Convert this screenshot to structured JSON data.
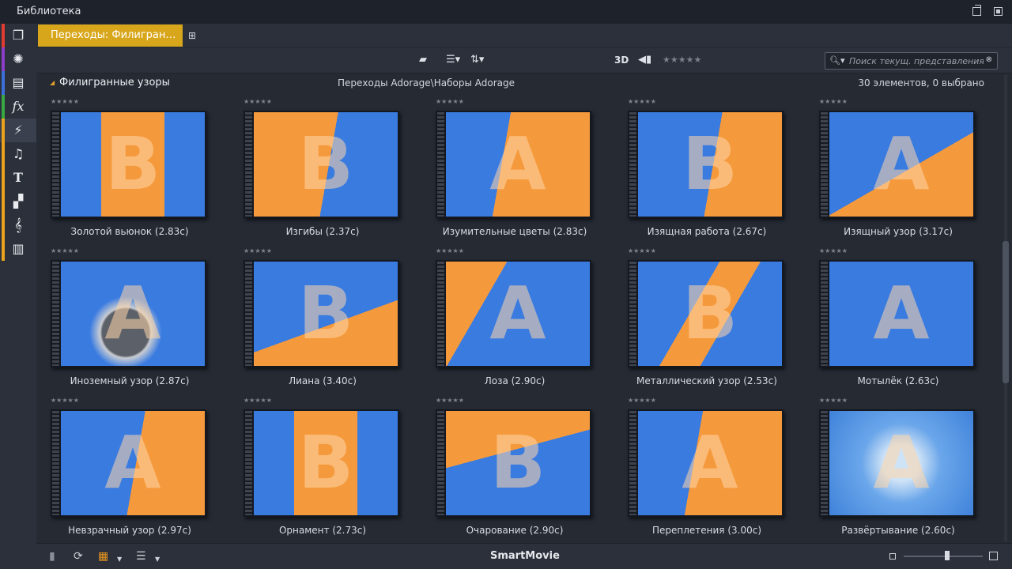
{
  "window": {
    "title": "Библиотека"
  },
  "sidebar": {
    "items": [
      {
        "name": "library-box-icon",
        "glyph": "❒",
        "color": "#e03c31"
      },
      {
        "name": "film-reel-icon",
        "glyph": "✺",
        "color": "#8a3ec9"
      },
      {
        "name": "photos-icon",
        "glyph": "▤",
        "color": "#3d6fd9"
      },
      {
        "name": "fx-icon",
        "glyph": "fx",
        "color": "#38a843"
      },
      {
        "name": "transition-bolt-icon",
        "glyph": "⚡",
        "color": "#e8a21c"
      },
      {
        "name": "music-note-icon",
        "glyph": "♫",
        "color": "#e8a21c"
      },
      {
        "name": "title-text-icon",
        "glyph": "T",
        "color": "#e8a21c"
      },
      {
        "name": "montage-icon",
        "glyph": "▞",
        "color": "#e8a21c"
      },
      {
        "name": "sound-effect-icon",
        "glyph": "𝄞",
        "color": "#e8a21c"
      },
      {
        "name": "disc-menu-icon",
        "glyph": "▥",
        "color": "#e8a21c"
      }
    ]
  },
  "tabs": {
    "active_label": "Переходы: Филигран…"
  },
  "toolbar": {
    "three_d": "3D",
    "stars": "★★★★★",
    "search_placeholder": "Поиск текущ. представления"
  },
  "content": {
    "folder_name": "Филигранные узоры",
    "path": "Переходы Adorage\\Наборы Adorage",
    "count": "30 элементов, 0 выбрано",
    "rating_stars": "★★★★★",
    "items": [
      {
        "label": "Золотой вьюнок (2.83с)",
        "letter": "B",
        "bg": "#3a7be0",
        "accent": "#f59a3c",
        "style": "stripe-v"
      },
      {
        "label": "Изгибы (2.37с)",
        "letter": "B",
        "bg": "#f59a3c",
        "accent": "#3a7be0",
        "style": "right"
      },
      {
        "label": "Изумительные цветы (2.83с)",
        "letter": "A",
        "bg": "#f59a3c",
        "accent": "#3a7be0",
        "style": "left"
      },
      {
        "label": "Изящная работа (2.67с)",
        "letter": "B",
        "bg": "#3a7be0",
        "accent": "#f59a3c",
        "style": "right"
      },
      {
        "label": "Изящный узор (3.17с)",
        "letter": "A",
        "bg": "#3a7be0",
        "accent": "#f59a3c",
        "style": "corner"
      },
      {
        "label": "Иноземный узор (2.87с)",
        "letter": "A",
        "bg": "#3a7be0",
        "accent": "#9aa3b0",
        "style": "gem"
      },
      {
        "label": "Лиана (3.40с)",
        "letter": "B",
        "bg": "#f59a3c",
        "accent": "#3a7be0",
        "style": "diag"
      },
      {
        "label": "Лоза (2.90с)",
        "letter": "A",
        "bg": "#3a7be0",
        "accent": "#f59a3c",
        "style": "left-diag"
      },
      {
        "label": "Металлический узор (2.53с)",
        "letter": "B",
        "bg": "#3a7be0",
        "accent": "#f59a3c",
        "style": "stripe-d"
      },
      {
        "label": "Мотылёк (2.63с)",
        "letter": "A",
        "bg": "#3a7be0",
        "accent": "#e8b84a",
        "style": "plain"
      },
      {
        "label": "Невзрачный узор (2.97с)",
        "letter": "A",
        "bg": "#3a7be0",
        "accent": "#f59a3c",
        "style": "right"
      },
      {
        "label": "Орнамент (2.73с)",
        "letter": "B",
        "bg": "#3a7be0",
        "accent": "#f59a3c",
        "style": "stripe-v"
      },
      {
        "label": "Очарование (2.90с)",
        "letter": "B",
        "bg": "#f59a3c",
        "accent": "#3a7be0",
        "style": "diag-low"
      },
      {
        "label": "Переплетения (3.00с)",
        "letter": "A",
        "bg": "#f59a3c",
        "accent": "#3a7be0",
        "style": "left"
      },
      {
        "label": "Развёртывание (2.60с)",
        "letter": "A",
        "bg": "#6aa6ea",
        "accent": "#f59a3c",
        "style": "burst"
      }
    ]
  },
  "footer": {
    "brand": "SmartMovie"
  }
}
